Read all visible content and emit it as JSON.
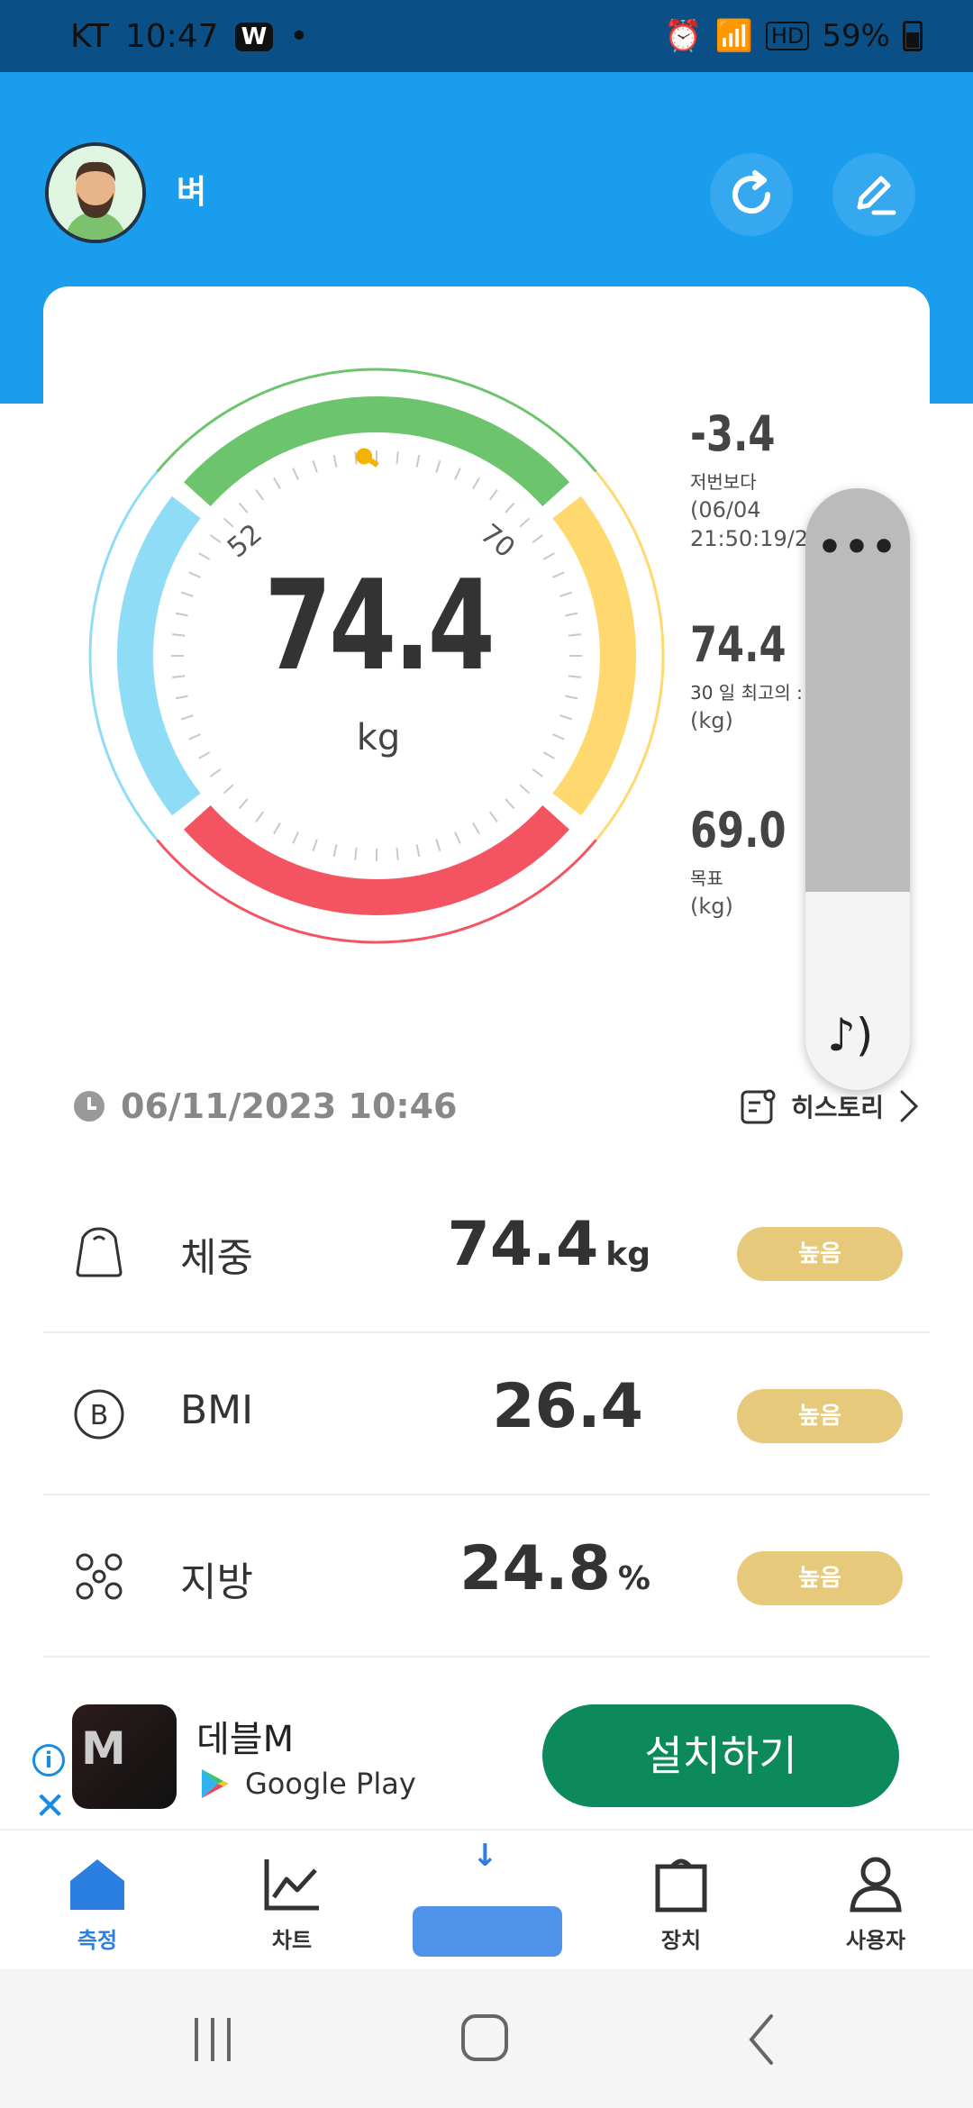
{
  "status_bar": {
    "carrier": "KT",
    "time": "10:47",
    "w_badge": "W",
    "hd": "HD",
    "battery": "59%"
  },
  "header": {
    "user_name": "벼"
  },
  "gauge": {
    "value": "74.4",
    "unit": "kg",
    "tick_left": "52",
    "tick_right": "70",
    "level": 0.74
  },
  "stats": [
    {
      "value": "-3.4",
      "label": "저번보다",
      "sub1": "(06/04",
      "sub2": "21:50:19/2"
    },
    {
      "value": "74.4",
      "label": "30 일 최고의 :",
      "sub1": "(kg)"
    },
    {
      "value": "69.0",
      "label": "목표",
      "sub1": "(kg)"
    }
  ],
  "side_panel": {
    "dots": "•••",
    "fill_level": 0.67
  },
  "measurement": {
    "datetime": "06/11/2023 10:46",
    "history_label": "히스토리"
  },
  "metrics": [
    {
      "name": "체중",
      "value": "74.4",
      "unit": "kg",
      "badge": "높음",
      "icon": "weight-icon"
    },
    {
      "name": "BMI",
      "value": "26.4",
      "unit": "",
      "badge": "높음",
      "icon": "bmi-icon"
    },
    {
      "name": "지방",
      "value": "24.8",
      "unit": "%",
      "badge": "높음",
      "icon": "fat-icon"
    }
  ],
  "ad": {
    "app_name": "데블M",
    "store": "Google Play",
    "install_label": "설치하기",
    "info": "i",
    "close": "✕"
  },
  "nav": {
    "items": [
      {
        "label": "측정",
        "active": true
      },
      {
        "label": "차트",
        "active": false
      },
      {
        "label": "장치",
        "active": false
      },
      {
        "label": "사용자",
        "active": false
      }
    ]
  },
  "colors": {
    "header": "#1a9ded",
    "green": "#6cc46c",
    "blue": "#8edcf5",
    "yellow": "#ffd870",
    "red": "#f45462",
    "badge": "#e6c97b",
    "install": "#0d8a5c",
    "accent": "#2a7fe0"
  }
}
